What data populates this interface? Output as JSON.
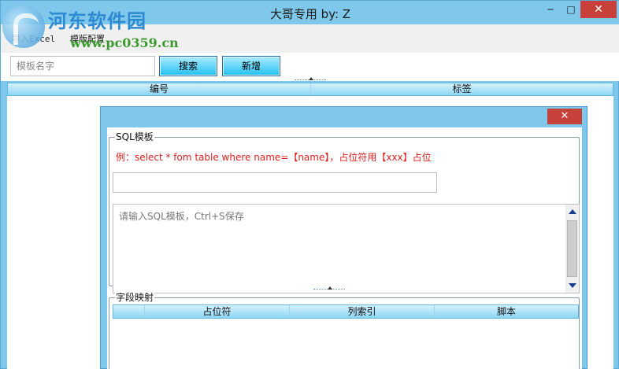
{
  "window": {
    "title": "大哥专用 by: Z",
    "minimize": "─",
    "maximize": "□",
    "close": "✕"
  },
  "watermark": {
    "name": "河东软件园",
    "url": "www.pc0359.cn"
  },
  "menu": [
    {
      "label": "导入Excel"
    },
    {
      "label": "模版配置"
    }
  ],
  "toolbar": {
    "search_placeholder": "模板名字",
    "search_value": "",
    "search_button": "搜索",
    "add_button": "新增"
  },
  "grid": {
    "columns": [
      "编号",
      "标签"
    ],
    "rows": []
  },
  "dialog": {
    "close": "✕",
    "sql_group_label": "SQL模板",
    "example_text": "例：select * fom table where name=【name】，占位符用【xxx】占位",
    "placeholder_value": "",
    "sql_placeholder": "请输入SQL模板，Ctrl+S保存",
    "mapping_group_label": "字段映射",
    "mapping_columns": [
      "",
      "占位符",
      "列索引",
      "脚本"
    ],
    "mapping_rows": []
  },
  "colors": {
    "chrome": "#7fc8ec",
    "button_gradient_top": "#aeecff",
    "button_gradient_bottom": "#23bff0",
    "close_red": "#c7403a",
    "example_red": "#e02020"
  },
  "icons": {
    "minimize": "minimize-icon",
    "maximize": "maximize-icon",
    "close": "close-icon",
    "scroll_up": "arrow-up-icon",
    "scroll_down": "arrow-down-icon",
    "splitter": "splitter-grip-icon"
  }
}
